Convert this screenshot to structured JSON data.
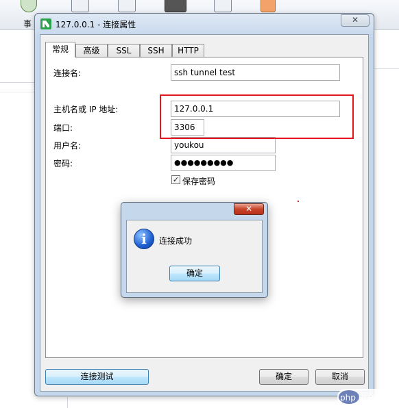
{
  "background": {
    "toolbar_partial_label": "事"
  },
  "dialog": {
    "title": "127.0.0.1 - 连接属性",
    "tabs": [
      "常规",
      "高级",
      "SSL",
      "SSH",
      "HTTP"
    ],
    "fields": {
      "connection_name": {
        "label": "连接名:",
        "value": "ssh tunnel test"
      },
      "host": {
        "label": "主机名或 IP 地址:",
        "value": "127.0.0.1"
      },
      "port": {
        "label": "端口:",
        "value": "3306"
      },
      "username": {
        "label": "用户名:",
        "value": "youkou"
      },
      "password": {
        "label": "密码:",
        "value": "●●●●●●●●●"
      }
    },
    "save_password": {
      "label": "保存密码",
      "checked": true
    },
    "buttons": {
      "test": "连接测试",
      "ok": "确定",
      "cancel": "取消"
    },
    "highlight_color": "#e5141a"
  },
  "message_box": {
    "message": "连接成功",
    "ok_label": "确定",
    "icon": "info-icon"
  },
  "watermark": {
    "text": "php 中文网"
  }
}
